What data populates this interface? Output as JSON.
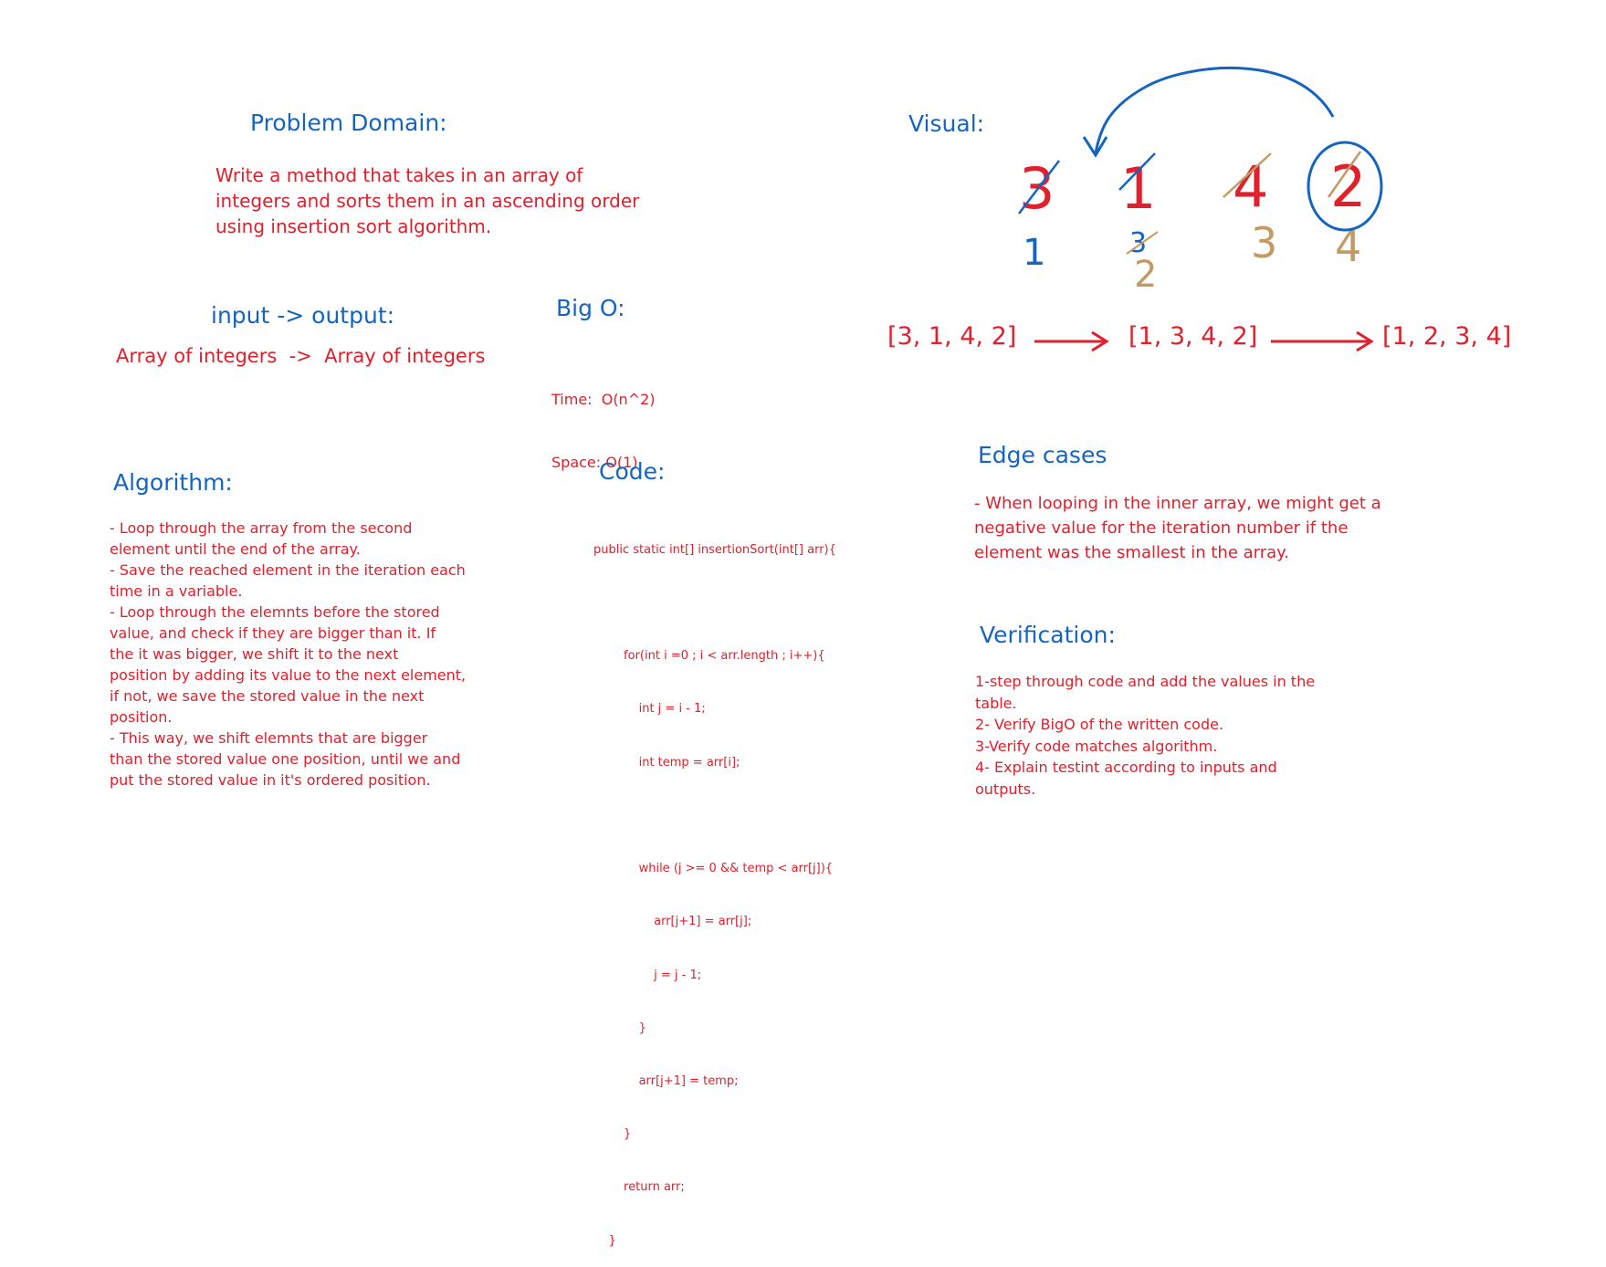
{
  "problem_domain": {
    "heading": "Problem Domain:",
    "lines": [
      "Write a method that takes in an array of",
      "integers and sorts them in an ascending order",
      "using insertion sort algorithm."
    ]
  },
  "io": {
    "heading": "input -> output:",
    "text": "Array of integers  ->  Array of integers"
  },
  "big_o": {
    "heading": "Big O:",
    "time": "Time:  O(n^2)",
    "space": "Space: O(1)"
  },
  "algorithm": {
    "heading": "Algorithm:",
    "lines": [
      "- Loop through the array from the second",
      "element until the end of the array.",
      "- Save the reached element in the iteration each",
      "time in a variable.",
      "- Loop through the elemnts before the stored",
      "value, and check if they are bigger than it. If",
      "the it was bigger, we shift it to the next",
      "position by adding its value to the next element,",
      "if not, we save the stored value in the next",
      "position.",
      "- This way, we shift elemnts that are bigger",
      "than the stored value one position, until we and",
      "put the stored value in it's ordered position."
    ]
  },
  "code": {
    "heading": "Code:",
    "lines": [
      "public static int[] insertionSort(int[] arr){",
      "",
      "        for(int i =0 ; i < arr.length ; i++){",
      "            int j = i - 1;",
      "            int temp = arr[i];",
      "",
      "            while (j >= 0 && temp < arr[j]){",
      "                arr[j+1] = arr[j];",
      "                j = j - 1;",
      "            }",
      "            arr[j+1] = temp;",
      "        }",
      "        return arr;",
      "    }"
    ]
  },
  "visual": {
    "heading": "Visual:",
    "digits": [
      "3",
      "1",
      "4",
      "2"
    ],
    "index_labels": [
      "1",
      "3",
      "2",
      "3",
      "4"
    ],
    "arrays": [
      "[3, 1, 4, 2]",
      "[1, 3, 4, 2]",
      "[1, 2, 3, 4]"
    ],
    "colors": {
      "red": "#e0202c",
      "blue": "#1565c0",
      "tan": "#c49a62"
    }
  },
  "edge_cases": {
    "heading": "Edge cases",
    "lines": [
      "- When looping in the inner array, we might get a",
      "negative value for the iteration number if the",
      "element was the smallest in the array."
    ]
  },
  "verification": {
    "heading": "Verification:",
    "lines": [
      "1-step through code and add the values in the",
      "table.",
      "2- Verify BigO of the written code.",
      "3-Verify code matches algorithm.",
      "4- Explain testint according to inputs and",
      "outputs."
    ]
  }
}
